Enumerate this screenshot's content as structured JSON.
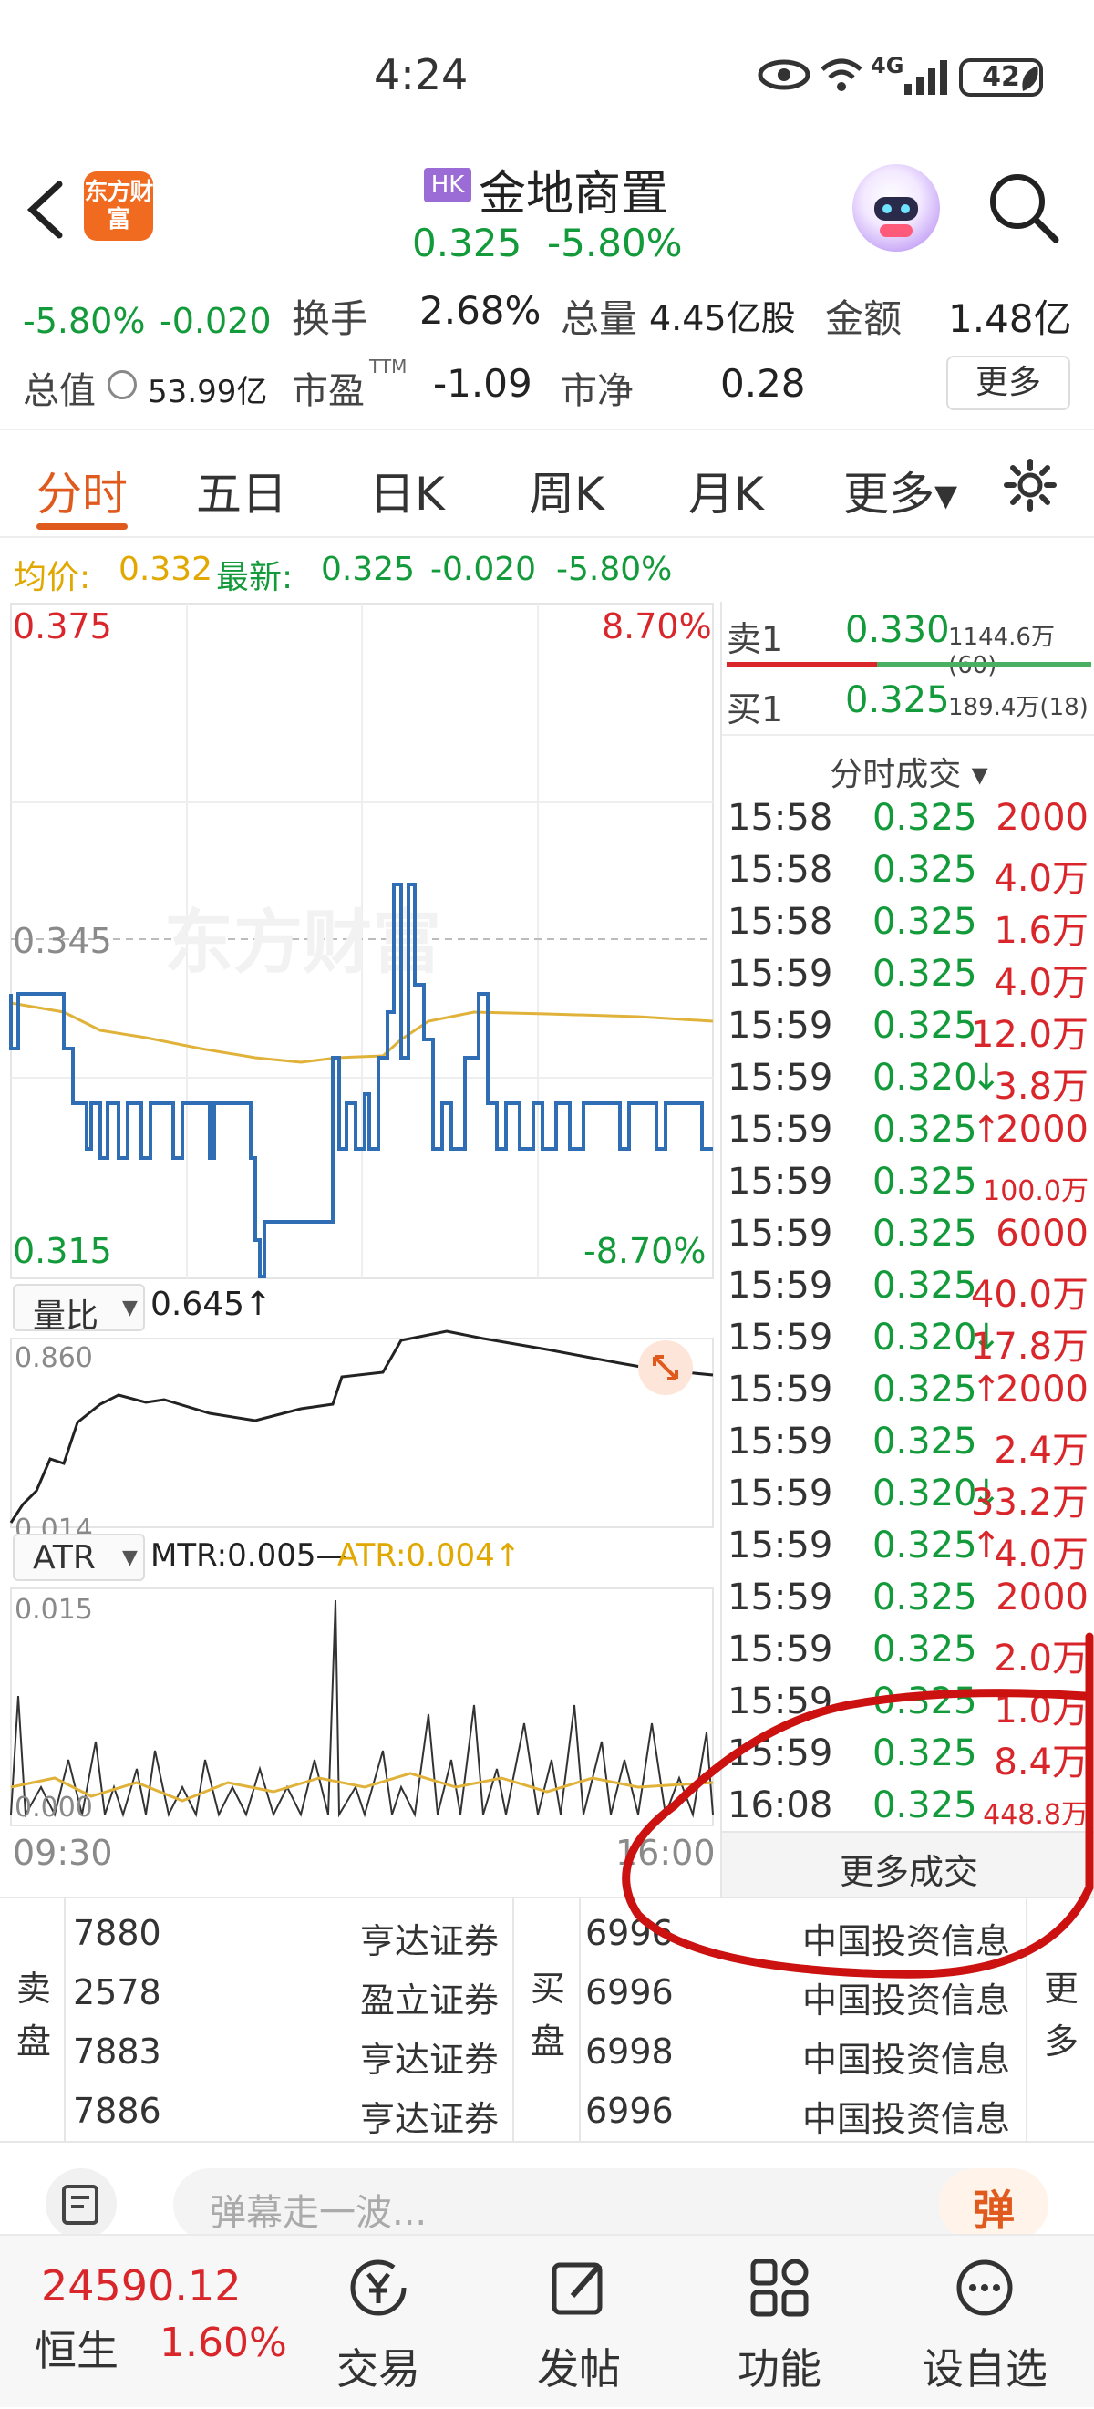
{
  "status_bar": {
    "time": "4:24",
    "network": "4G",
    "battery": "42"
  },
  "header": {
    "back_icon": "chevron-left-icon",
    "app_logo_text": "东方财富",
    "market_badge": "HK",
    "stock_name": "金地商置",
    "price": "0.325",
    "change_pct": "-5.80%",
    "search_icon": "search-icon"
  },
  "quote": {
    "change_pct": "-5.80%",
    "change": "-0.020",
    "turnover_label": "换手",
    "turnover": "2.68%",
    "volume_label": "总量",
    "volume": "4.45亿股",
    "amount_label": "金额",
    "amount": "1.48亿",
    "mktcap_label": "总值",
    "mktcap": "53.99亿",
    "pe_label": "市盈",
    "pe_sup": "TTM",
    "pe": "-1.09",
    "pb_label": "市净",
    "pb": "0.28",
    "more_button": "更多"
  },
  "tabs": [
    {
      "label": "分时",
      "active": true
    },
    {
      "label": "五日"
    },
    {
      "label": "日K"
    },
    {
      "label": "周K"
    },
    {
      "label": "月K"
    },
    {
      "label": "更多▾"
    }
  ],
  "avg_line": {
    "avg_label": "均价:",
    "avg_value": "0.332",
    "latest_label": "最新:",
    "latest_value": "0.325",
    "change": "-0.020",
    "change_pct": "-5.80%"
  },
  "price_chart": {
    "top_price": "0.375",
    "top_pct": "8.70%",
    "mid_price": "0.345",
    "bottom_price": "0.315",
    "bottom_pct": "-8.70%",
    "watermark": "东方财富"
  },
  "volume_ratio": {
    "selector": "量比",
    "value": "0.645↑",
    "top": "0.860",
    "bottom": "0.014"
  },
  "atr": {
    "selector": "ATR",
    "mtr": "MTR:0.005—",
    "atr_value": "ATR:0.004↑",
    "top": "0.015",
    "bottom": "0.000",
    "time_start": "09:30",
    "time_end": "16:00"
  },
  "order_book": {
    "sell_label": "卖1",
    "sell_price": "0.330",
    "sell_vol": "1144.6万(60)",
    "buy_label": "买1",
    "buy_price": "0.325",
    "buy_vol": "189.4万(18)"
  },
  "ticks_header": "分时成交 ▾",
  "ticks": [
    {
      "time": "15:58",
      "price": "0.325",
      "dir": "",
      "vol": "2000"
    },
    {
      "time": "15:58",
      "price": "0.325",
      "dir": "",
      "vol": "4.0万"
    },
    {
      "time": "15:58",
      "price": "0.325",
      "dir": "",
      "vol": "1.6万"
    },
    {
      "time": "15:59",
      "price": "0.325",
      "dir": "",
      "vol": "4.0万"
    },
    {
      "time": "15:59",
      "price": "0.325",
      "dir": "",
      "vol": "12.0万"
    },
    {
      "time": "15:59",
      "price": "0.320",
      "dir": "↓",
      "vol": "3.8万"
    },
    {
      "time": "15:59",
      "price": "0.325",
      "dir": "↑",
      "vol": "2000"
    },
    {
      "time": "15:59",
      "price": "0.325",
      "dir": "",
      "vol": "100.0万"
    },
    {
      "time": "15:59",
      "price": "0.325",
      "dir": "",
      "vol": "6000"
    },
    {
      "time": "15:59",
      "price": "0.325",
      "dir": "",
      "vol": "40.0万"
    },
    {
      "time": "15:59",
      "price": "0.320",
      "dir": "↓",
      "vol": "17.8万"
    },
    {
      "time": "15:59",
      "price": "0.325",
      "dir": "↑",
      "vol": "2000"
    },
    {
      "time": "15:59",
      "price": "0.325",
      "dir": "",
      "vol": "2.4万"
    },
    {
      "time": "15:59",
      "price": "0.320",
      "dir": "↓",
      "vol": "33.2万"
    },
    {
      "time": "15:59",
      "price": "0.325",
      "dir": "↑",
      "vol": "4.0万"
    },
    {
      "time": "15:59",
      "price": "0.325",
      "dir": "",
      "vol": "2000"
    },
    {
      "time": "15:59",
      "price": "0.325",
      "dir": "",
      "vol": "2.0万"
    },
    {
      "time": "15:59",
      "price": "0.325",
      "dir": "",
      "vol": "1.0万"
    },
    {
      "time": "15:59",
      "price": "0.325",
      "dir": "",
      "vol": "8.4万"
    },
    {
      "time": "16:08",
      "price": "0.325",
      "dir": "",
      "vol": "448.8万"
    }
  ],
  "more_ticks_button": "更多成交",
  "broker_queue": {
    "sell_label": "卖盘",
    "buy_label": "买盘",
    "more_label": "更多",
    "sell_rows": [
      {
        "id": "7880",
        "name": "亨达证券"
      },
      {
        "id": "2578",
        "name": "盈立证券"
      },
      {
        "id": "7883",
        "name": "亨达证券"
      },
      {
        "id": "7886",
        "name": "亨达证券"
      }
    ],
    "buy_rows": [
      {
        "id": "6996",
        "name": "中国投资信息"
      },
      {
        "id": "6996",
        "name": "中国投资信息"
      },
      {
        "id": "6998",
        "name": "中国投资信息"
      },
      {
        "id": "6996",
        "name": "中国投资信息"
      }
    ]
  },
  "comment_bar": {
    "placeholder": "弹幕走一波...",
    "danmu_button": "弹"
  },
  "bottom_nav": {
    "index_value": "24590.12",
    "index_name": "恒生",
    "index_pct": "1.60%",
    "items": [
      {
        "label": "交易",
        "icon": "yen-icon"
      },
      {
        "label": "发帖",
        "icon": "edit-icon"
      },
      {
        "label": "功能",
        "icon": "grid-icon"
      },
      {
        "label": "设自选",
        "icon": "more-circle-icon"
      }
    ]
  },
  "colors": {
    "up": "#d9262b",
    "down": "#139a3a",
    "accent": "#e05a1e",
    "price_line": "#2f6db5",
    "avg_line": "#e0b23a",
    "annotation": "#cc1111"
  }
}
